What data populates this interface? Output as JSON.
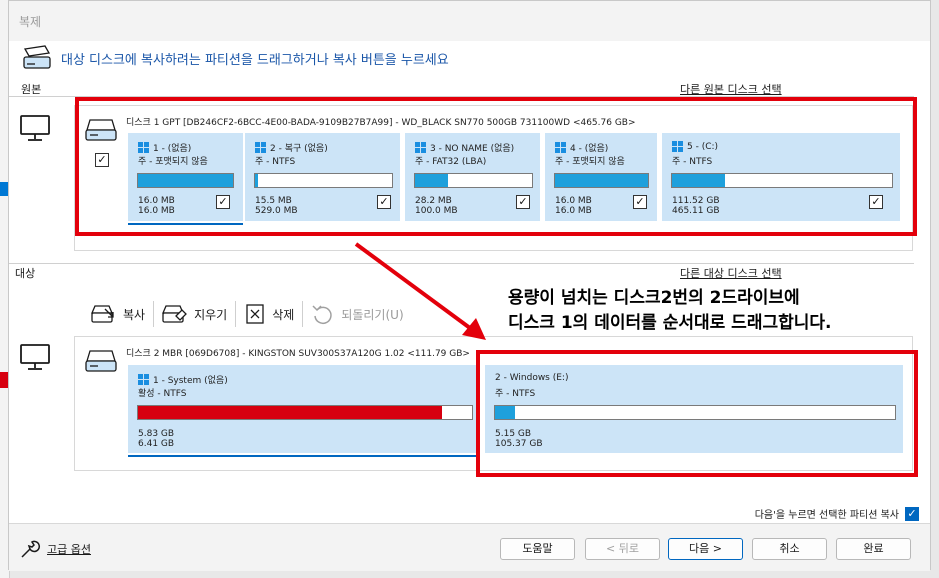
{
  "window": {
    "title": "복제"
  },
  "instruction": "대상 디스크에 복사하려는 파티션을 드래그하거나 복사 버튼을 누르세요",
  "source": {
    "section_label": "원본",
    "select_link": "다른 원본 디스크 선택",
    "disk_title": "디스크 1 GPT [DB246CF2-6BCC-4E00-BADA-9109B27B7A99] - WD_BLACK SN770 500GB 731100WD  <465.76 GB>",
    "disk_checked": true,
    "partitions": [
      {
        "name": "1 - (없음)",
        "fs": "주 - 포맷되지 않음",
        "used": "16.0 MB",
        "total": "16.0 MB",
        "fill": 1.0,
        "checked": true
      },
      {
        "name": "2 - 복구 (없음)",
        "fs": "주 - NTFS",
        "used": "15.5 MB",
        "total": "529.0 MB",
        "fill": 0.02,
        "checked": true
      },
      {
        "name": "3 - NO NAME (없음)",
        "fs": "주 - FAT32 (LBA)",
        "used": "28.2 MB",
        "total": "100.0 MB",
        "fill": 0.28,
        "checked": true
      },
      {
        "name": "4 - (없음)",
        "fs": "주 - 포맷되지 않음",
        "used": "16.0 MB",
        "total": "16.0 MB",
        "fill": 1.0,
        "checked": true
      },
      {
        "name": "5 - (C:)",
        "fs": "주 - NTFS",
        "used": "111.52 GB",
        "total": "465.11 GB",
        "fill": 0.24,
        "checked": true
      }
    ]
  },
  "target": {
    "section_label": "대상",
    "select_link": "다른 대상 디스크 선택",
    "toolbar": {
      "copy": "복사",
      "erase": "지우기",
      "delete": "삭제",
      "undo": "되돌리기(U)"
    },
    "disk_title": "디스크 2 MBR [069D6708] - KINGSTON  SUV300S37A120G  1.02  <111.79 GB>",
    "partitions": [
      {
        "name": "1 - System (없음)",
        "fs": "활성 - NTFS",
        "used": "5.83 GB",
        "total": "6.41 GB",
        "fill": 0.91,
        "color": "#d7000f"
      },
      {
        "name": "2 - Windows (E:)",
        "fs": "주 - NTFS",
        "used": "5.15 GB",
        "total": "105.37 GB",
        "fill": 0.05,
        "color": "#1ea0dc"
      }
    ]
  },
  "annotation": {
    "line1": "용량이 넘치는 디스크2번의 2드라이브에",
    "line2": "디스크 1의 데이터를 순서대로 드래그합니다."
  },
  "option": {
    "label": "다음'을 누르면 선택한 파티션 복사",
    "checked": true
  },
  "footer": {
    "advanced": "고급 옵션",
    "help": "도움말",
    "back": "< 뒤로",
    "next": "다음 >",
    "cancel": "취소",
    "finish": "완료"
  },
  "colors": {
    "accent": "#0067c0",
    "partition_bg": "#cce4f7",
    "bar_fill": "#1ea0dc",
    "overflow_fill": "#d7000f",
    "annotation_red": "#e3000b"
  }
}
